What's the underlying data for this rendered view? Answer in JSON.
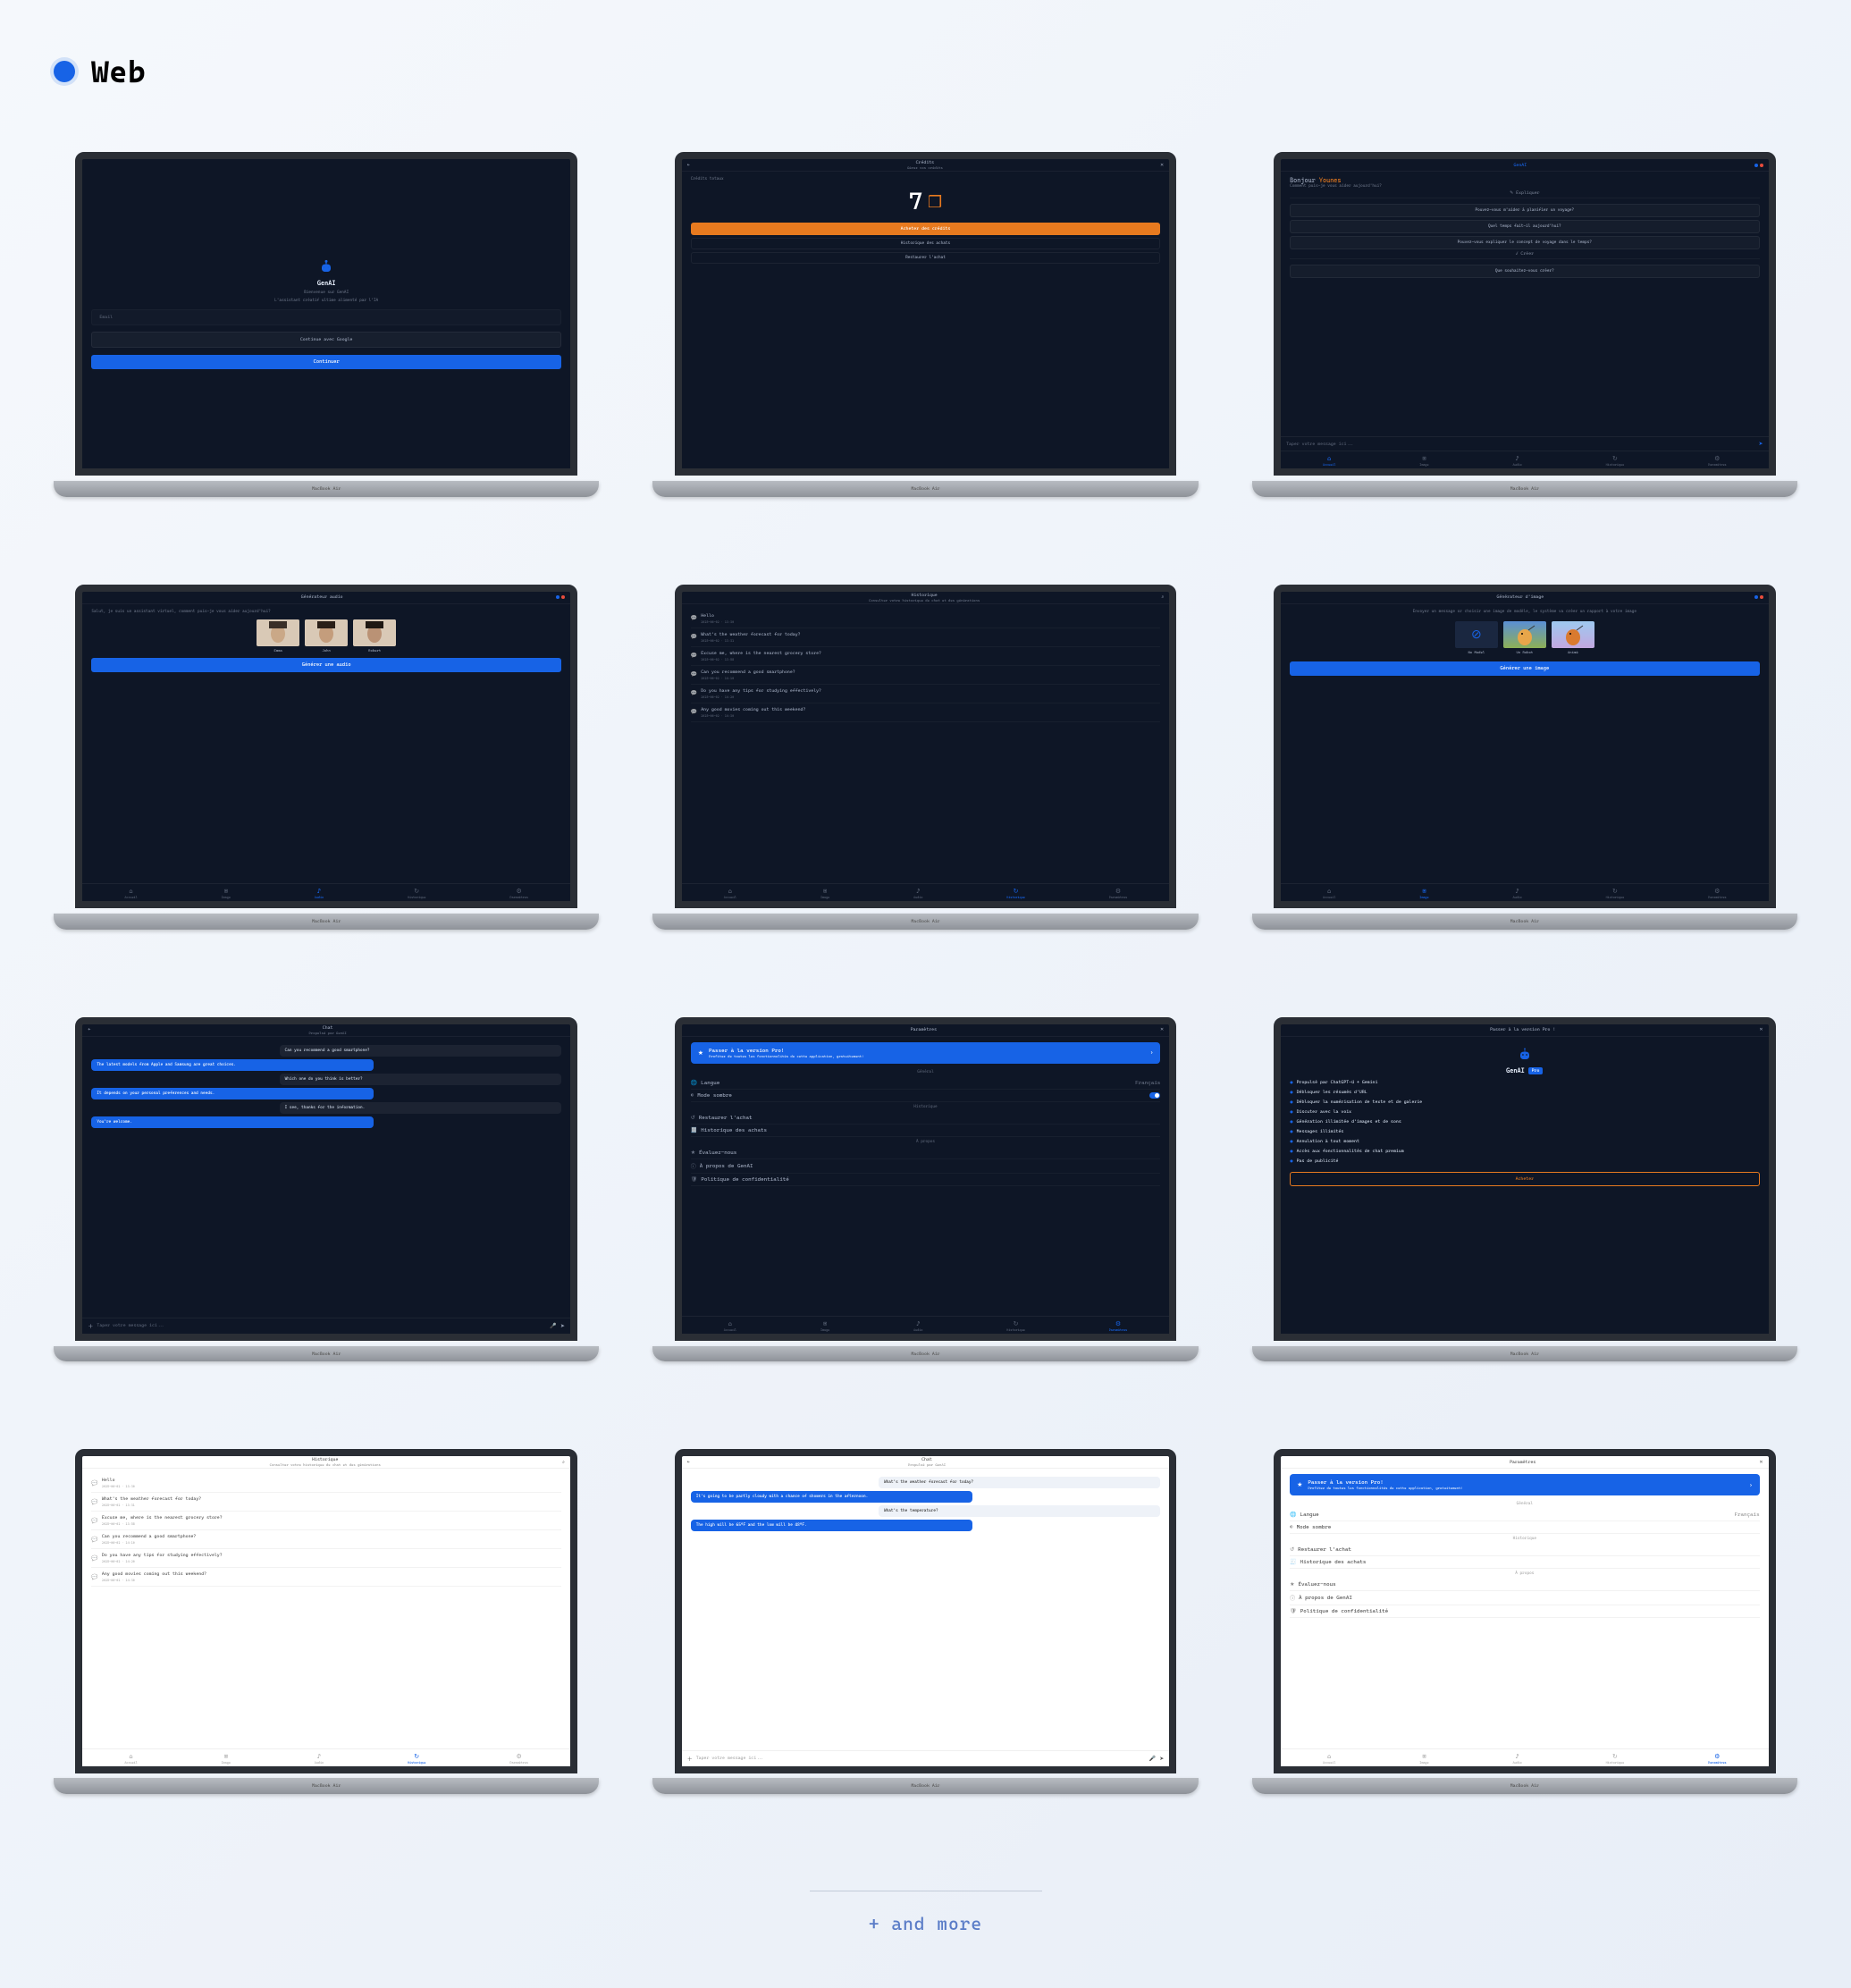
{
  "page": {
    "section_title": "Web",
    "footer_more": "+ and more",
    "laptop_brand": "MacBook Air"
  },
  "nav": {
    "home": "Accueil",
    "image": "Image",
    "audio": "Audio",
    "history": "Historique",
    "settings": "Paramètres"
  },
  "s1_login": {
    "brand": "GenAI",
    "welcome": "Bienvenue sur GenAI",
    "tagline": "L'assistant créatif ultime alimenté par l'IA",
    "email_placeholder": "Email",
    "google_btn": "Continue avec Google",
    "continue": "Continuer"
  },
  "s2_credits": {
    "title": "Crédits",
    "subtitle": "Gérez vos crédits",
    "totals_label": "Crédits totaux",
    "count": "7",
    "buy": "Acheter des crédits",
    "history": "Historique des achats",
    "restore": "Restaurer l'achat"
  },
  "s3_home": {
    "title": "GenAI",
    "greet_prefix": "Bonjour",
    "greet_name": "Younes",
    "greet_sub": "Comment puis-je vous aider aujourd'hui?",
    "explain_head": "✎ Expliquer",
    "explain_1": "Pouvez-vous m'aider à planifier un voyage?",
    "explain_2": "Quel temps fait-il aujourd'hui?",
    "explain_3": "Pouvez-vous expliquer le concept de voyage dans le temps?",
    "create_head": "✓ Créer",
    "create_1": "Que souhaitez-vous créer?",
    "input_ph": "Taper votre message ici..."
  },
  "s4_audio": {
    "title": "Générateur audio",
    "prompt": "Salut, je suis un assistant virtuel, comment puis-je vous aider aujourd'hui?",
    "avatars": [
      "Emma",
      "John",
      "Robert"
    ],
    "generate": "Générer une audio"
  },
  "s5_history": {
    "title": "Historique",
    "subtitle": "Consulter votre historique de chat et des générations",
    "items": [
      {
        "text": "Hello",
        "time": "2025-06-02 · 13:30"
      },
      {
        "text": "What's the weather forecast for today?",
        "time": "2025-06-02 · 13:31"
      },
      {
        "text": "Excuse me, where is the nearest grocery store?",
        "time": "2025-06-02 · 13:58"
      },
      {
        "text": "Can you recommend a good smartphone?",
        "time": "2025-06-02 · 14:10"
      },
      {
        "text": "Do you have any tips for studying effectively?",
        "time": "2025-06-02 · 14:20"
      },
      {
        "text": "Any good movies coming out this weekend?",
        "time": "2025-06-02 · 14:30"
      }
    ]
  },
  "s6_image": {
    "title": "Générateur d'image",
    "subtitle": "Envoyer un message or choisir une image de modèle, le système va créer un rapport à votre image",
    "images": [
      {
        "label": "No Model"
      },
      {
        "label": "Un Robot"
      },
      {
        "label": "Animé"
      }
    ],
    "generate": "Générer une image"
  },
  "s7_chat": {
    "title": "Chat",
    "subtitle": "Propulsé par GenAI",
    "msgs": [
      {
        "side": "right",
        "text": "Can you recommend a good smartphone?"
      },
      {
        "side": "left",
        "text": "The latest models from Apple and Samsung are great choices."
      },
      {
        "side": "right",
        "text": "Which one do you think is better?"
      },
      {
        "side": "left",
        "text": "It depends on your personal preferences and needs."
      },
      {
        "side": "right",
        "text": "I see, thanks for the information."
      },
      {
        "side": "left",
        "text": "You're welcome."
      }
    ],
    "input_ph": "Taper votre message ici..."
  },
  "s8_settings": {
    "title": "Paramètres",
    "banner_title": "Passer à la version Pro!",
    "banner_sub": "Profitez de toutes les fonctionnalités de cette application, gratuitement!",
    "sec_general": "Général",
    "lang_label": "Langue",
    "lang_value": "Français",
    "dark_label": "Mode sombre",
    "sec_history": "Historique",
    "restore_label": "Restaurer l'achat",
    "achats_label": "Historique des achats",
    "sec_about": "À propos",
    "rate_label": "Évaluez-nous",
    "about_label": "À propos de GenAI",
    "privacy_label": "Politique de confidentialité"
  },
  "s9_pro": {
    "title": "Passer à la version Pro !",
    "brand": "GenAI",
    "badge": "Pro",
    "features": [
      "Propulsé par ChatGPT-4 + Gemini",
      "Débloquer les résumés d'URL",
      "Débloquer la numérisation de texte et de galerie",
      "Discuter avec la voix",
      "Génération illimitée d'images et de sons",
      "Messages illimités",
      "Annulation à tout moment",
      "Accès aux fonctionnalités de chat premium",
      "Pas de publicité"
    ],
    "buy": "Acheter"
  },
  "s10_history_light": {
    "title": "Historique",
    "subtitle": "Consulter votre historique de chat et des générations",
    "items": [
      {
        "text": "Hello",
        "time": "2025-06-02 · 13:30"
      },
      {
        "text": "What's the weather forecast for today?",
        "time": "2025-06-02 · 13:31"
      },
      {
        "text": "Excuse me, where is the nearest grocery store?",
        "time": "2025-06-02 · 13:58"
      },
      {
        "text": "Can you recommend a good smartphone?",
        "time": "2025-06-02 · 14:10"
      },
      {
        "text": "Do you have any tips for studying effectively?",
        "time": "2025-06-02 · 14:20"
      },
      {
        "text": "Any good movies coming out this weekend?",
        "time": "2025-06-02 · 14:30"
      }
    ]
  },
  "s11_chat_light": {
    "title": "Chat",
    "subtitle": "Propulsé par GenAI",
    "msgs": [
      {
        "side": "right",
        "text": "What's the weather forecast for today?"
      },
      {
        "side": "left",
        "text": "It's going to be partly cloudy with a chance of showers in the afternoon."
      },
      {
        "side": "right",
        "text": "What's the temperature?"
      },
      {
        "side": "left",
        "text": "The high will be 65°F and the low will be 48°F."
      }
    ],
    "input_ph": "Taper votre message ici..."
  },
  "s12_settings_light": {
    "title": "Paramètres",
    "banner_title": "Passer à la version Pro!",
    "banner_sub": "Profitez de toutes les fonctionnalités de cette application, gratuitement!",
    "sec_general": "Général",
    "lang_label": "Langue",
    "lang_value": "Français",
    "dark_label": "Mode sombre",
    "sec_history": "Historique",
    "restore_label": "Restaurer l'achat",
    "achats_label": "Historique des achats",
    "sec_about": "À propos",
    "rate_label": "Évaluez-nous",
    "about_label": "À propos de GenAI",
    "privacy_label": "Politique de confidentialité"
  }
}
